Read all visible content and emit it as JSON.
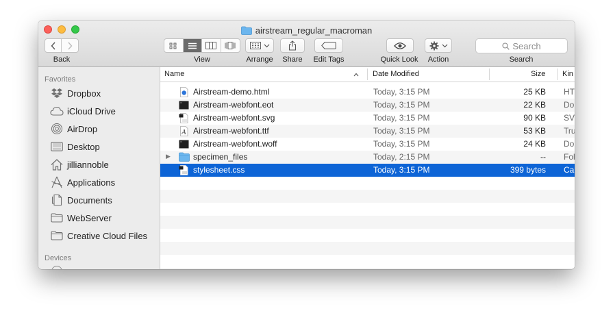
{
  "window": {
    "title": "airstream_regular_macroman"
  },
  "toolbar": {
    "back_label": "Back",
    "view_label": "View",
    "arrange_label": "Arrange",
    "share_label": "Share",
    "edit_tags_label": "Edit Tags",
    "quick_look_label": "Quick Look",
    "action_label": "Action",
    "search_label": "Search",
    "search_placeholder": "Search"
  },
  "sidebar": {
    "favorites_heading": "Favorites",
    "items": [
      {
        "label": "Dropbox",
        "icon": "dropbox-icon"
      },
      {
        "label": "iCloud Drive",
        "icon": "cloud-icon"
      },
      {
        "label": "AirDrop",
        "icon": "airdrop-icon"
      },
      {
        "label": "Desktop",
        "icon": "desktop-icon"
      },
      {
        "label": "jilliannoble",
        "icon": "home-icon"
      },
      {
        "label": "Applications",
        "icon": "applications-icon"
      },
      {
        "label": "Documents",
        "icon": "documents-icon"
      },
      {
        "label": "WebServer",
        "icon": "folder-icon"
      },
      {
        "label": "Creative Cloud Files",
        "icon": "folder-icon"
      }
    ],
    "devices_heading": "Devices"
  },
  "columns": {
    "name": "Name",
    "date": "Date Modified",
    "size": "Size",
    "kind": "Kin"
  },
  "files": [
    {
      "name": "Airstream-demo.html",
      "date": "Today, 3:15 PM",
      "size": "25 KB",
      "kind": "HT",
      "icon": "html-file-icon"
    },
    {
      "name": "Airstream-webfont.eot",
      "date": "Today, 3:15 PM",
      "size": "22 KB",
      "kind": "Do",
      "icon": "terminal-file-icon"
    },
    {
      "name": "Airstream-webfont.svg",
      "date": "Today, 3:15 PM",
      "size": "90 KB",
      "kind": "SV",
      "icon": "svg-file-icon"
    },
    {
      "name": "Airstream-webfont.ttf",
      "date": "Today, 3:15 PM",
      "size": "53 KB",
      "kind": "Tru",
      "icon": "font-file-icon"
    },
    {
      "name": "Airstream-webfont.woff",
      "date": "Today, 3:15 PM",
      "size": "24 KB",
      "kind": "Do",
      "icon": "terminal-file-icon"
    },
    {
      "name": "specimen_files",
      "date": "Today, 2:15 PM",
      "size": "--",
      "kind": "Fol",
      "icon": "folder-icon"
    },
    {
      "name": "stylesheet.css",
      "date": "Today, 3:15 PM",
      "size": "399 bytes",
      "kind": "Ca",
      "icon": "css-file-icon"
    }
  ],
  "colors": {
    "selection": "#0d64d6",
    "folder": "#5aa9e6",
    "accent_blue": "#2b74d9"
  }
}
